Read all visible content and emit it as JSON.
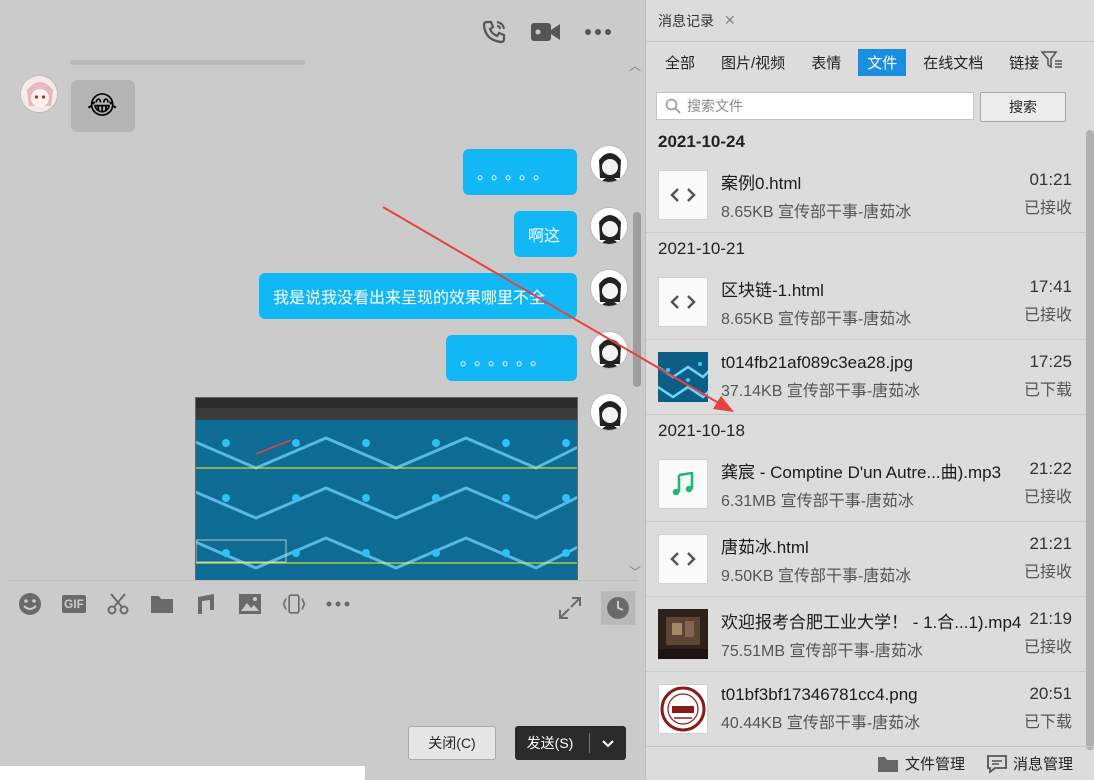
{
  "chat": {
    "messages": [
      {
        "side": "left",
        "type": "emoji",
        "emoji": "😂"
      },
      {
        "side": "right",
        "type": "text",
        "text": "。。。。。"
      },
      {
        "side": "right",
        "type": "text",
        "text": "啊这"
      },
      {
        "side": "right",
        "type": "text",
        "text": "我是说我没看出来呈现的效果哪里不全"
      },
      {
        "side": "right",
        "type": "text",
        "text": "。。。。。。"
      },
      {
        "side": "right",
        "type": "image"
      }
    ],
    "toolbar_icons": [
      "emoji-icon",
      "gif-icon",
      "scissors-icon",
      "folder-icon",
      "music-icon",
      "image-icon",
      "shake-icon",
      "more-icon",
      "expand-icon",
      "history-icon"
    ],
    "gif_label": "GIF",
    "close_label": "关闭(C)",
    "send_label": "发送(S)"
  },
  "records": {
    "title": "消息记录",
    "filters": [
      "全部",
      "图片/视频",
      "表情",
      "文件",
      "在线文档",
      "链接"
    ],
    "active_filter": "文件",
    "search_placeholder": "搜索文件",
    "search_button": "搜索",
    "groups": [
      {
        "date": "2021-10-24",
        "files": [
          {
            "name": "案例0.html",
            "size": "8.65KB",
            "sender": "宣传部干事-唐茹冰",
            "time": "01:21",
            "status": "已接收",
            "kind": "code"
          }
        ]
      },
      {
        "date": "2021-10-21",
        "files": [
          {
            "name": "区块链-1.html",
            "size": "8.65KB",
            "sender": "宣传部干事-唐茹冰",
            "time": "17:41",
            "status": "已接收",
            "kind": "code"
          },
          {
            "name": "t014fb21af089c3ea28.jpg",
            "size": "37.14KB",
            "sender": "宣传部干事-唐茹冰",
            "time": "17:25",
            "status": "已下载",
            "kind": "image"
          }
        ]
      },
      {
        "date": "2021-10-18",
        "files": [
          {
            "name": "龚宸 - Comptine D'un Autre...曲).mp3",
            "size": "6.31MB",
            "sender": "宣传部干事-唐茹冰",
            "time": "21:22",
            "status": "已接收",
            "kind": "music"
          },
          {
            "name": "唐茹冰.html",
            "size": "9.50KB",
            "sender": "宣传部干事-唐茹冰",
            "time": "21:21",
            "status": "已接收",
            "kind": "code"
          },
          {
            "name": "欢迎报考合肥工业大学！ - 1.合...1).mp4",
            "size": "75.51MB",
            "sender": "宣传部干事-唐茹冰",
            "time": "21:19",
            "status": "已接收",
            "kind": "video"
          },
          {
            "name": "t01bf3bf17346781cc4.png",
            "size": "40.44KB",
            "sender": "宣传部干事-唐茹冰",
            "time": "20:51",
            "status": "已下载",
            "kind": "seal"
          }
        ]
      }
    ],
    "footer": {
      "file_manage": "文件管理",
      "msg_manage": "消息管理"
    }
  },
  "colors": {
    "accent": "#1a8fe0",
    "bubble": "#12b7f5",
    "arrow": "#e8403f"
  }
}
